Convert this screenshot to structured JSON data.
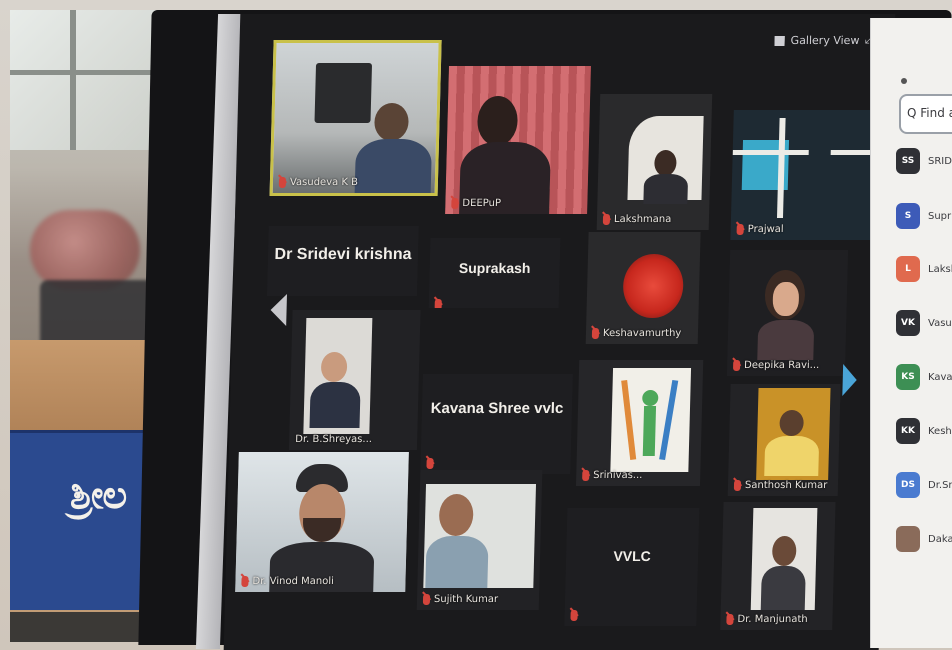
{
  "scene": {
    "banner_text": "ಶ್ರೀಲ"
  },
  "meeting": {
    "view_label": "Gallery View",
    "fullscreen_glyph": "⤢",
    "tiles": [
      {
        "name": "Vasudeva K B"
      },
      {
        "name": "DEEPuP"
      },
      {
        "name": "Lakshmana"
      },
      {
        "name": "Prajwal"
      },
      {
        "big": "Dr Sridevi krishna"
      },
      {
        "big": "Suprakash"
      },
      {
        "name": "Keshavamurthy"
      },
      {
        "name": "Deepika Ravi..."
      },
      {
        "name": "Dr. B.Shreyas..."
      },
      {
        "big": "Kavana Shree vvlc"
      },
      {
        "name": "Srinivas..."
      },
      {
        "name": "Santhosh Kumar"
      },
      {
        "name": "Dr. Vinod Manoli"
      },
      {
        "name": "Sujith Kumar"
      },
      {
        "big": "VVLC"
      },
      {
        "name": "Dr. Manjunath"
      }
    ]
  },
  "participants_panel": {
    "search_text": "Q Find a",
    "items": [
      {
        "initials": "SS",
        "label": "SRIDE",
        "color": "#2f3035"
      },
      {
        "initials": "S",
        "label": "Supr",
        "color": "#3d5bb8"
      },
      {
        "initials": "L",
        "label": "Laksh",
        "color": "#e06a4e"
      },
      {
        "initials": "VK",
        "label": "Vasud",
        "color": "#2f3035"
      },
      {
        "initials": "KS",
        "label": "Kavan",
        "color": "#3d8f54"
      },
      {
        "initials": "KK",
        "label": "Keshi",
        "color": "#2f3035"
      },
      {
        "initials": "DS",
        "label": "Dr.Sri",
        "color": "#4a7bd0"
      },
      {
        "initials": "",
        "label": "Dakash",
        "color": "#8a6b5a"
      }
    ]
  }
}
